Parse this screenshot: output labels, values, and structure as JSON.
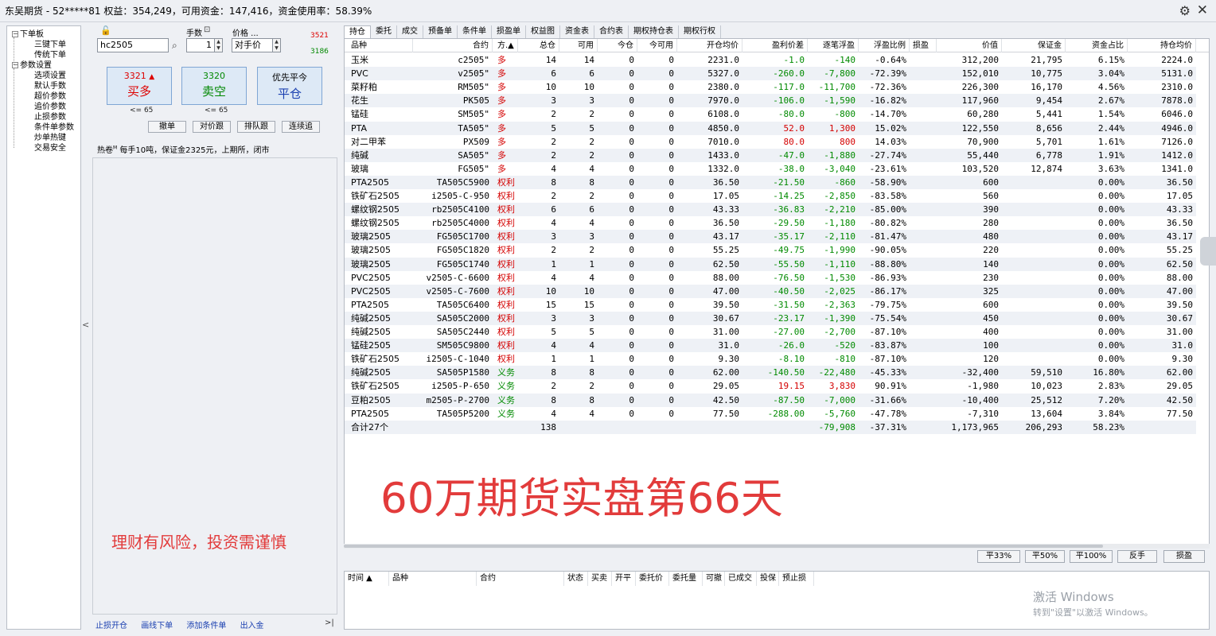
{
  "title": "东吴期货 - 52*****81  权益：354,249，可用资金：147,416，资金使用率：58.39%",
  "nav": {
    "items": [
      {
        "label": "下单板",
        "level": 0,
        "box": "−"
      },
      {
        "label": "三键下单",
        "level": 1
      },
      {
        "label": "传统下单",
        "level": 1
      },
      {
        "label": "参数设置",
        "level": 0,
        "box": "−"
      },
      {
        "label": "选项设置",
        "level": 1
      },
      {
        "label": "默认手数",
        "level": 1
      },
      {
        "label": "超价参数",
        "level": 1
      },
      {
        "label": "追价参数",
        "level": 1
      },
      {
        "label": "止损参数",
        "level": 1
      },
      {
        "label": "条件单参数",
        "level": 1
      },
      {
        "label": "炒单热键",
        "level": 1
      },
      {
        "label": "交易安全",
        "level": 1
      }
    ]
  },
  "order": {
    "contract": "hc2505",
    "qty_label": "手数",
    "qty": "1",
    "price_label": "价格 ...",
    "price_mode": "对手价",
    "ask": "3521",
    "bid": "3186",
    "buy": {
      "price": "3321",
      "label": "买多",
      "arrow": "▲"
    },
    "sell": {
      "price": "3320",
      "label": "卖空"
    },
    "close": {
      "price": "优先平今",
      "label": "平仓"
    },
    "buy_note": "<= 65",
    "sell_note": "<= 65",
    "buttons": [
      "撤单",
      "对价跟",
      "排队跟",
      "连续追"
    ]
  },
  "hot": {
    "name": "热卷",
    "sup": "M",
    "desc": "每手10吨，保证金2325元，上期所，闭市"
  },
  "risk_text": "理财有风险，投资需谨慎",
  "bottom_links": [
    "止损开仓",
    "画线下单",
    "添加条件单",
    "出入金"
  ],
  "collapse_left": "<",
  "collapse_right": ">|",
  "tabs": [
    "持仓",
    "委托",
    "成交",
    "预备单",
    "条件单",
    "损盈单",
    "权益图",
    "资金表",
    "合约表",
    "期权持仓表",
    "期权行权"
  ],
  "table": {
    "headers": [
      "品种",
      "合约",
      "方.▲",
      "总仓",
      "可用",
      "今仓",
      "今可用",
      "开仓均价",
      "盈利价差",
      "逐笔浮盈",
      "浮盈比例",
      "损盈",
      "价值",
      "保证金",
      "资金占比",
      "持仓均价"
    ],
    "rows": [
      {
        "name": "玉米",
        "code": "c2505\"",
        "dir": "多",
        "total": "14",
        "avail": "14",
        "today": "0",
        "todayAvail": "0",
        "open": "2231.0",
        "diff": "-1.0",
        "pnl": "-140",
        "ratio": "-0.64%",
        "sl": "",
        "value": "312,200",
        "margin": "21,795",
        "share": "6.15%",
        "avg": "2224.0",
        "sign": "neg"
      },
      {
        "name": "PVC",
        "code": "v2505\"",
        "dir": "多",
        "total": "6",
        "avail": "6",
        "today": "0",
        "todayAvail": "0",
        "open": "5327.0",
        "diff": "-260.0",
        "pnl": "-7,800",
        "ratio": "-72.39%",
        "sl": "",
        "value": "152,010",
        "margin": "10,775",
        "share": "3.04%",
        "avg": "5131.0",
        "sign": "neg"
      },
      {
        "name": "菜籽粕",
        "code": "RM505\"",
        "dir": "多",
        "total": "10",
        "avail": "10",
        "today": "0",
        "todayAvail": "0",
        "open": "2380.0",
        "diff": "-117.0",
        "pnl": "-11,700",
        "ratio": "-72.36%",
        "sl": "",
        "value": "226,300",
        "margin": "16,170",
        "share": "4.56%",
        "avg": "2310.0",
        "sign": "neg"
      },
      {
        "name": "花生",
        "code": "PK505",
        "dir": "多",
        "total": "3",
        "avail": "3",
        "today": "0",
        "todayAvail": "0",
        "open": "7970.0",
        "diff": "-106.0",
        "pnl": "-1,590",
        "ratio": "-16.82%",
        "sl": "",
        "value": "117,960",
        "margin": "9,454",
        "share": "2.67%",
        "avg": "7878.0",
        "sign": "neg"
      },
      {
        "name": "锰硅",
        "code": "SM505\"",
        "dir": "多",
        "total": "2",
        "avail": "2",
        "today": "0",
        "todayAvail": "0",
        "open": "6108.0",
        "diff": "-80.0",
        "pnl": "-800",
        "ratio": "-14.70%",
        "sl": "",
        "value": "60,280",
        "margin": "5,441",
        "share": "1.54%",
        "avg": "6046.0",
        "sign": "neg"
      },
      {
        "name": "PTA",
        "code": "TA505\"",
        "dir": "多",
        "total": "5",
        "avail": "5",
        "today": "0",
        "todayAvail": "0",
        "open": "4850.0",
        "diff": "52.0",
        "pnl": "1,300",
        "ratio": "15.02%",
        "sl": "",
        "value": "122,550",
        "margin": "8,656",
        "share": "2.44%",
        "avg": "4946.0",
        "sign": "pos"
      },
      {
        "name": "对二甲苯",
        "code": "PX509",
        "dir": "多",
        "total": "2",
        "avail": "2",
        "today": "0",
        "todayAvail": "0",
        "open": "7010.0",
        "diff": "80.0",
        "pnl": "800",
        "ratio": "14.03%",
        "sl": "",
        "value": "70,900",
        "margin": "5,701",
        "share": "1.61%",
        "avg": "7126.0",
        "sign": "pos"
      },
      {
        "name": "纯碱",
        "code": "SA505\"",
        "dir": "多",
        "total": "2",
        "avail": "2",
        "today": "0",
        "todayAvail": "0",
        "open": "1433.0",
        "diff": "-47.0",
        "pnl": "-1,880",
        "ratio": "-27.74%",
        "sl": "",
        "value": "55,440",
        "margin": "6,778",
        "share": "1.91%",
        "avg": "1412.0",
        "sign": "neg"
      },
      {
        "name": "玻璃",
        "code": "FG505\"",
        "dir": "多",
        "total": "4",
        "avail": "4",
        "today": "0",
        "todayAvail": "0",
        "open": "1332.0",
        "diff": "-38.0",
        "pnl": "-3,040",
        "ratio": "-23.61%",
        "sl": "",
        "value": "103,520",
        "margin": "12,874",
        "share": "3.63%",
        "avg": "1341.0",
        "sign": "neg"
      },
      {
        "name": "PTA2505",
        "code": "TA505C5900",
        "dir": "权利",
        "total": "8",
        "avail": "8",
        "today": "0",
        "todayAvail": "0",
        "open": "36.50",
        "diff": "-21.50",
        "pnl": "-860",
        "ratio": "-58.90%",
        "sl": "",
        "value": "600",
        "margin": "",
        "share": "0.00%",
        "avg": "36.50",
        "sign": "neg"
      },
      {
        "name": "铁矿石2505",
        "code": "i2505-C-950",
        "dir": "权利",
        "total": "2",
        "avail": "2",
        "today": "0",
        "todayAvail": "0",
        "open": "17.05",
        "diff": "-14.25",
        "pnl": "-2,850",
        "ratio": "-83.58%",
        "sl": "",
        "value": "560",
        "margin": "",
        "share": "0.00%",
        "avg": "17.05",
        "sign": "neg"
      },
      {
        "name": "螺纹钢2505",
        "code": "rb2505C4100",
        "dir": "权利",
        "total": "6",
        "avail": "6",
        "today": "0",
        "todayAvail": "0",
        "open": "43.33",
        "diff": "-36.83",
        "pnl": "-2,210",
        "ratio": "-85.00%",
        "sl": "",
        "value": "390",
        "margin": "",
        "share": "0.00%",
        "avg": "43.33",
        "sign": "neg"
      },
      {
        "name": "螺纹钢2505",
        "code": "rb2505C4000",
        "dir": "权利",
        "total": "4",
        "avail": "4",
        "today": "0",
        "todayAvail": "0",
        "open": "36.50",
        "diff": "-29.50",
        "pnl": "-1,180",
        "ratio": "-80.82%",
        "sl": "",
        "value": "280",
        "margin": "",
        "share": "0.00%",
        "avg": "36.50",
        "sign": "neg"
      },
      {
        "name": "玻璃2505",
        "code": "FG505C1700",
        "dir": "权利",
        "total": "3",
        "avail": "3",
        "today": "0",
        "todayAvail": "0",
        "open": "43.17",
        "diff": "-35.17",
        "pnl": "-2,110",
        "ratio": "-81.47%",
        "sl": "",
        "value": "480",
        "margin": "",
        "share": "0.00%",
        "avg": "43.17",
        "sign": "neg"
      },
      {
        "name": "玻璃2505",
        "code": "FG505C1820",
        "dir": "权利",
        "total": "2",
        "avail": "2",
        "today": "0",
        "todayAvail": "0",
        "open": "55.25",
        "diff": "-49.75",
        "pnl": "-1,990",
        "ratio": "-90.05%",
        "sl": "",
        "value": "220",
        "margin": "",
        "share": "0.00%",
        "avg": "55.25",
        "sign": "neg"
      },
      {
        "name": "玻璃2505",
        "code": "FG505C1740",
        "dir": "权利",
        "total": "1",
        "avail": "1",
        "today": "0",
        "todayAvail": "0",
        "open": "62.50",
        "diff": "-55.50",
        "pnl": "-1,110",
        "ratio": "-88.80%",
        "sl": "",
        "value": "140",
        "margin": "",
        "share": "0.00%",
        "avg": "62.50",
        "sign": "neg"
      },
      {
        "name": "PVC2505",
        "code": "v2505-C-6600",
        "dir": "权利",
        "total": "4",
        "avail": "4",
        "today": "0",
        "todayAvail": "0",
        "open": "88.00",
        "diff": "-76.50",
        "pnl": "-1,530",
        "ratio": "-86.93%",
        "sl": "",
        "value": "230",
        "margin": "",
        "share": "0.00%",
        "avg": "88.00",
        "sign": "neg"
      },
      {
        "name": "PVC2505",
        "code": "v2505-C-7600",
        "dir": "权利",
        "total": "10",
        "avail": "10",
        "today": "0",
        "todayAvail": "0",
        "open": "47.00",
        "diff": "-40.50",
        "pnl": "-2,025",
        "ratio": "-86.17%",
        "sl": "",
        "value": "325",
        "margin": "",
        "share": "0.00%",
        "avg": "47.00",
        "sign": "neg"
      },
      {
        "name": "PTA2505",
        "code": "TA505C6400",
        "dir": "权利",
        "total": "15",
        "avail": "15",
        "today": "0",
        "todayAvail": "0",
        "open": "39.50",
        "diff": "-31.50",
        "pnl": "-2,363",
        "ratio": "-79.75%",
        "sl": "",
        "value": "600",
        "margin": "",
        "share": "0.00%",
        "avg": "39.50",
        "sign": "neg"
      },
      {
        "name": "纯碱2505",
        "code": "SA505C2000",
        "dir": "权利",
        "total": "3",
        "avail": "3",
        "today": "0",
        "todayAvail": "0",
        "open": "30.67",
        "diff": "-23.17",
        "pnl": "-1,390",
        "ratio": "-75.54%",
        "sl": "",
        "value": "450",
        "margin": "",
        "share": "0.00%",
        "avg": "30.67",
        "sign": "neg"
      },
      {
        "name": "纯碱2505",
        "code": "SA505C2440",
        "dir": "权利",
        "total": "5",
        "avail": "5",
        "today": "0",
        "todayAvail": "0",
        "open": "31.00",
        "diff": "-27.00",
        "pnl": "-2,700",
        "ratio": "-87.10%",
        "sl": "",
        "value": "400",
        "margin": "",
        "share": "0.00%",
        "avg": "31.00",
        "sign": "neg"
      },
      {
        "name": "锰硅2505",
        "code": "SM505C9800",
        "dir": "权利",
        "total": "4",
        "avail": "4",
        "today": "0",
        "todayAvail": "0",
        "open": "31.0",
        "diff": "-26.0",
        "pnl": "-520",
        "ratio": "-83.87%",
        "sl": "",
        "value": "100",
        "margin": "",
        "share": "0.00%",
        "avg": "31.0",
        "sign": "neg"
      },
      {
        "name": "铁矿石2505",
        "code": "i2505-C-1040",
        "dir": "权利",
        "total": "1",
        "avail": "1",
        "today": "0",
        "todayAvail": "0",
        "open": "9.30",
        "diff": "-8.10",
        "pnl": "-810",
        "ratio": "-87.10%",
        "sl": "",
        "value": "120",
        "margin": "",
        "share": "0.00%",
        "avg": "9.30",
        "sign": "neg"
      },
      {
        "name": "纯碱2505",
        "code": "SA505P1580",
        "dir": "义务",
        "total": "8",
        "avail": "8",
        "today": "0",
        "todayAvail": "0",
        "open": "62.00",
        "diff": "-140.50",
        "pnl": "-22,480",
        "ratio": "-45.33%",
        "sl": "",
        "value": "-32,400",
        "margin": "59,510",
        "share": "16.80%",
        "avg": "62.00",
        "sign": "neg"
      },
      {
        "name": "铁矿石2505",
        "code": "i2505-P-650",
        "dir": "义务",
        "total": "2",
        "avail": "2",
        "today": "0",
        "todayAvail": "0",
        "open": "29.05",
        "diff": "19.15",
        "pnl": "3,830",
        "ratio": "90.91%",
        "sl": "",
        "value": "-1,980",
        "margin": "10,023",
        "share": "2.83%",
        "avg": "29.05",
        "sign": "pos"
      },
      {
        "name": "豆粕2505",
        "code": "m2505-P-2700",
        "dir": "义务",
        "total": "8",
        "avail": "8",
        "today": "0",
        "todayAvail": "0",
        "open": "42.50",
        "diff": "-87.50",
        "pnl": "-7,000",
        "ratio": "-31.66%",
        "sl": "",
        "value": "-10,400",
        "margin": "25,512",
        "share": "7.20%",
        "avg": "42.50",
        "sign": "neg"
      },
      {
        "name": "PTA2505",
        "code": "TA505P5200",
        "dir": "义务",
        "total": "4",
        "avail": "4",
        "today": "0",
        "todayAvail": "0",
        "open": "77.50",
        "diff": "-288.00",
        "pnl": "-5,760",
        "ratio": "-47.78%",
        "sl": "",
        "value": "-7,310",
        "margin": "13,604",
        "share": "3.84%",
        "avg": "77.50",
        "sign": "neg"
      }
    ],
    "total": {
      "name": "合计27个",
      "code": "",
      "dir": "",
      "total": "138",
      "avail": "",
      "today": "",
      "todayAvail": "",
      "open": "",
      "diff": "",
      "pnl": "-79,908",
      "ratio": "-37.31%",
      "sl": "",
      "value": "1,173,965",
      "margin": "206,293",
      "share": "58.23%",
      "avg": "",
      "sign": "neg"
    }
  },
  "overlay": "60万期货实盘第66天",
  "action_buttons": [
    "平33%",
    "平50%",
    "平100%",
    "反手",
    "损盈"
  ],
  "order_headers": [
    "时间 ▲",
    "品种",
    "合约",
    "状态",
    "买卖",
    "开平",
    "委托价",
    "委托量",
    "可撤",
    "已成交",
    "投保",
    "预止损"
  ],
  "watermark": {
    "line1": "激活 Windows",
    "line2": "转到\"设置\"以激活 Windows。"
  },
  "colors": {
    "up": "#d40000",
    "down": "#008a00",
    "dir_long": "#d40000",
    "dir_right": "#d40000",
    "dir_duty": "#008a00",
    "accent": "#e23b3b"
  }
}
